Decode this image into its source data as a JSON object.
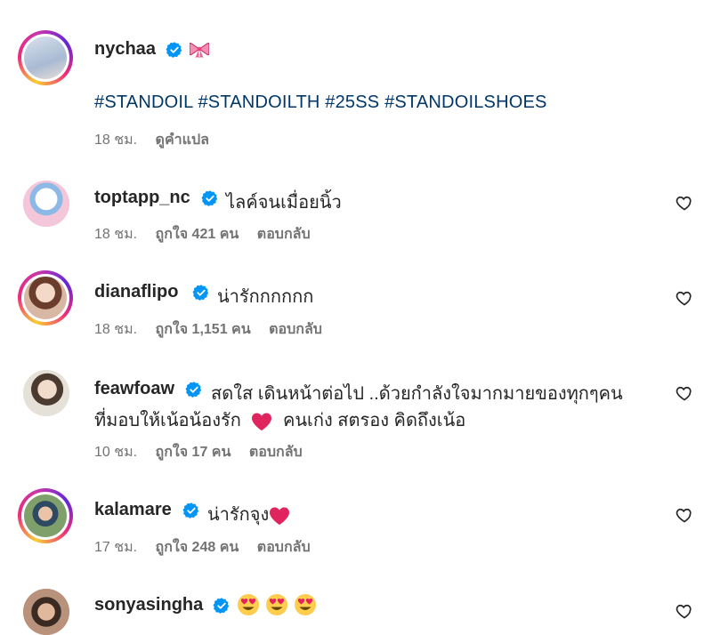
{
  "caption": {
    "username": "nycha",
    "username_tail": "a",
    "hashtags": "#STANDOIL #STANDOILTH #25SS #STANDOILSHOES",
    "time": "18 ชม.",
    "translate": "ดูคำแปล",
    "avatar_colors": [
      "#cfd8e6",
      "#8fa6c4"
    ]
  },
  "comments": [
    {
      "username": "toptapp_nc",
      "text": "ไลค์จนเมื่อยนิ้ว",
      "time": "18 ชม.",
      "likes": "ถูกใจ 421 คน",
      "reply": "ตอบกลับ",
      "avatar_colors": [
        "#f2c1d8",
        "#7fb0e0"
      ]
    },
    {
      "username": "dianaflipo",
      "text": "น่ารักกกกกก",
      "time": "18 ชม.",
      "likes": "ถูกใจ 1,151 คน",
      "reply": "ตอบกลับ",
      "avatar_colors": [
        "#f1d6c8",
        "#8a5a44"
      ]
    },
    {
      "username": "feawfoaw",
      "text": "สดใส เดินหน้าต่อไป ..ด้วยกำลังใจมากมายของทุกๆคน",
      "text2a": "ที่มอบให้เน้อน้องรัก",
      "text2b": "คนเก่ง สตรอง คิดถึงเน้อ",
      "time": "10 ชม.",
      "likes": "ถูกใจ 17 คน",
      "reply": "ตอบกลับ",
      "avatar_colors": [
        "#e9e4dc",
        "#6b5a4a"
      ]
    },
    {
      "username": "kalamare",
      "text": "น่ารักจุง",
      "time": "17 ชม.",
      "likes": "ถูกใจ 248 คน",
      "reply": "ตอบกลับ",
      "avatar_colors": [
        "#7fa06a",
        "#2e4a63"
      ]
    },
    {
      "username": "sonyasingha",
      "text": "",
      "avatar_colors": [
        "#c49a80",
        "#3a2a22"
      ]
    }
  ],
  "colors": {
    "verified": "#0095f6",
    "heart_red": "#e0245e",
    "ring": "#ee2a7b"
  },
  "icons": {
    "verified": "verified-badge-icon",
    "bow": "pink-bow-emoji",
    "like": "heart-outline-icon",
    "red_heart": "red-heart-emoji",
    "heart_eyes": "heart-eyes-emoji"
  }
}
